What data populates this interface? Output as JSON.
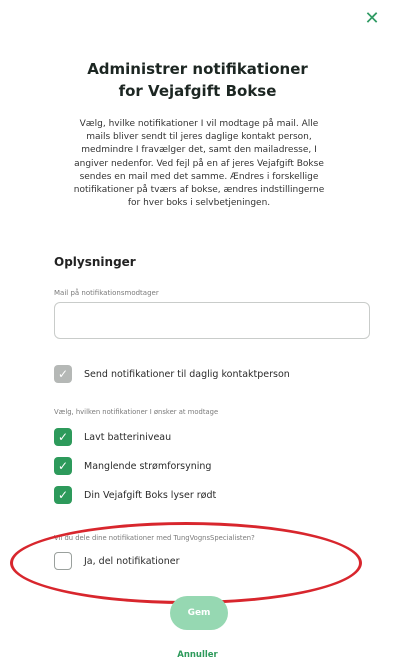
{
  "dialog": {
    "close_icon": "close-icon",
    "title_line1": "Administrer notifikationer",
    "title_line2": "for Vejafgift Bokse",
    "intro": [
      "Vælg, hvilke notifikationer I vil modtage på mail. Alle",
      "mails bliver sendt til jeres daglige kontakt person,",
      "medmindre I fravælger det, samt den mailadresse, I",
      "angiver nedenfor. Ved fejl på en af jeres Vejafgift Bokse",
      "sendes en mail med det samme. Ændres i forskellige",
      "notifikationer på tværs af bokse, ændres indstillingerne",
      "for hver boks i selvbetjeningen."
    ]
  },
  "info": {
    "heading": "Oplysninger",
    "email_label": "Mail på notifikationsmodtager",
    "email_value": "",
    "send_daily_contact": {
      "label": "Send notifikationer til daglig kontaktperson",
      "checked": true,
      "disabled": true
    }
  },
  "notifications": {
    "label": "Vælg, hvilken notifikationer I ønsker at modtage",
    "options": [
      {
        "label": "Lavt batteriniveau",
        "checked": true
      },
      {
        "label": "Manglende strømforsyning",
        "checked": true
      },
      {
        "label": "Din Vejafgift Boks lyser rødt",
        "checked": true
      }
    ]
  },
  "share": {
    "question": "Vil du dele dine notifikationer med TungVognsSpecialisten?",
    "label": "Ja, del notifikationer",
    "checked": false
  },
  "actions": {
    "save": "Gem",
    "cancel": "Annuller"
  },
  "colors": {
    "accent": "#2d9a5b",
    "save_button": "#96d8b2",
    "highlight": "#d8262d"
  }
}
